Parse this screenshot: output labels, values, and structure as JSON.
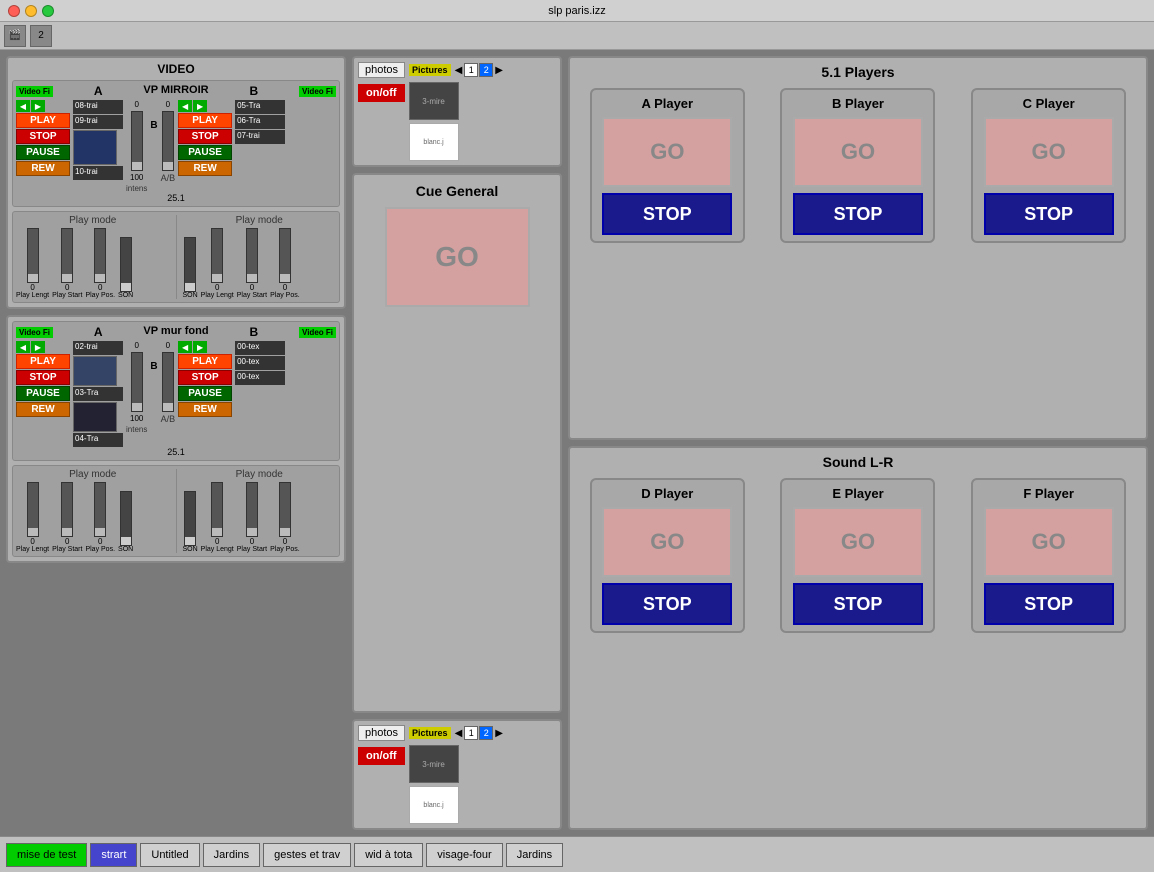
{
  "titlebar": {
    "title": "slp paris.izz"
  },
  "toolbar": {
    "icon1": "🎬",
    "icon2": "2"
  },
  "video_section": {
    "title": "VIDEO",
    "vp_mirroir": {
      "title": "VP MIRROIR",
      "label_A": "A",
      "label_B": "B",
      "btn_play": "PLAY",
      "btn_stop": "STOP",
      "btn_pause": "PAUSE",
      "btn_rew": "REW",
      "tracks_left": [
        "08-trai",
        "09-trai",
        "10-trai"
      ],
      "tracks_right": [
        "05-Tra",
        "06-Tra",
        "07-trai"
      ],
      "intens": "intens",
      "val_0_left": "0",
      "val_100_left": "100",
      "val_0_right": "0",
      "ab_label": "A/B",
      "perc_label": "25.1"
    },
    "vp_mur_fond": {
      "title": "VP mur fond",
      "label_A": "A",
      "label_B": "B",
      "btn_play": "PLAY",
      "btn_stop": "STOP",
      "btn_pause": "PAUSE",
      "btn_rew": "REW",
      "tracks_left": [
        "02-trai",
        "03-Tra",
        "04-Tra"
      ],
      "tracks_right": [
        "00-tex",
        "00-tex",
        "00-tex"
      ],
      "intens": "intens",
      "val_0_left": "0",
      "val_100_left": "100",
      "val_0_right": "0",
      "ab_label": "A/B",
      "perc_label": "25.1"
    }
  },
  "playmode_top": {
    "left_title": "Play mode",
    "right_title": "Play mode",
    "sliders": {
      "left": {
        "labels": [
          "Play Lengt",
          "Play Start",
          "Play Pos.",
          "SON"
        ],
        "values": [
          "0",
          "0",
          "0",
          ""
        ]
      },
      "right": {
        "labels": [
          "SON",
          "Play Lengt",
          "Play Start",
          "Play Pos."
        ],
        "values": [
          "0",
          "0",
          "0",
          ""
        ]
      }
    }
  },
  "playmode_bottom": {
    "left_title": "Play mode",
    "right_title": "Play mode",
    "sliders": {
      "left": {
        "labels": [
          "Play Lengt",
          "Play Start",
          "Play Pos.",
          "SON"
        ],
        "values": [
          "0",
          "0",
          "0",
          ""
        ]
      },
      "right": {
        "labels": [
          "SON",
          "Play Lengt",
          "Play Start",
          "Play Pos."
        ],
        "values": [
          "0",
          "0",
          "0",
          ""
        ]
      }
    }
  },
  "pictures_top": {
    "label": "photos",
    "badge": "Pictures",
    "nav_nums": [
      "1",
      "2"
    ],
    "thumb1": "3-mire",
    "thumb2": "blanc.j",
    "btn_onoff": "on/off"
  },
  "pictures_bottom": {
    "label": "photos",
    "badge": "Pictures",
    "nav_nums": [
      "1",
      "2"
    ],
    "thumb1": "3-mire",
    "thumb2": "blanc.j",
    "btn_onoff": "on/off"
  },
  "cue_general": {
    "title": "Cue General",
    "btn_go": "GO"
  },
  "players_51": {
    "title": "5.1 Players",
    "players": [
      {
        "name": "A Player",
        "btn_go": "GO",
        "btn_stop": "STOP"
      },
      {
        "name": "B Player",
        "btn_go": "GO",
        "btn_stop": "STOP"
      },
      {
        "name": "C Player",
        "btn_go": "GO",
        "btn_stop": "STOP"
      }
    ]
  },
  "sound_lr": {
    "title": "Sound L-R",
    "players": [
      {
        "name": "D Player",
        "btn_go": "GO",
        "btn_stop": "STOP"
      },
      {
        "name": "E Player",
        "btn_go": "GO",
        "btn_stop": "STOP"
      },
      {
        "name": "F Player",
        "btn_go": "GO",
        "btn_stop": "STOP"
      }
    ]
  },
  "bottom_tabs": {
    "tabs": [
      {
        "label": "mise de test",
        "state": "green"
      },
      {
        "label": "strart",
        "state": "blue"
      },
      {
        "label": "Untitled",
        "state": ""
      },
      {
        "label": "Jardins",
        "state": ""
      },
      {
        "label": "gestes et trav",
        "state": ""
      },
      {
        "label": "wid à tota",
        "state": ""
      },
      {
        "label": "visage-four",
        "state": ""
      },
      {
        "label": "Jardins",
        "state": ""
      }
    ]
  }
}
